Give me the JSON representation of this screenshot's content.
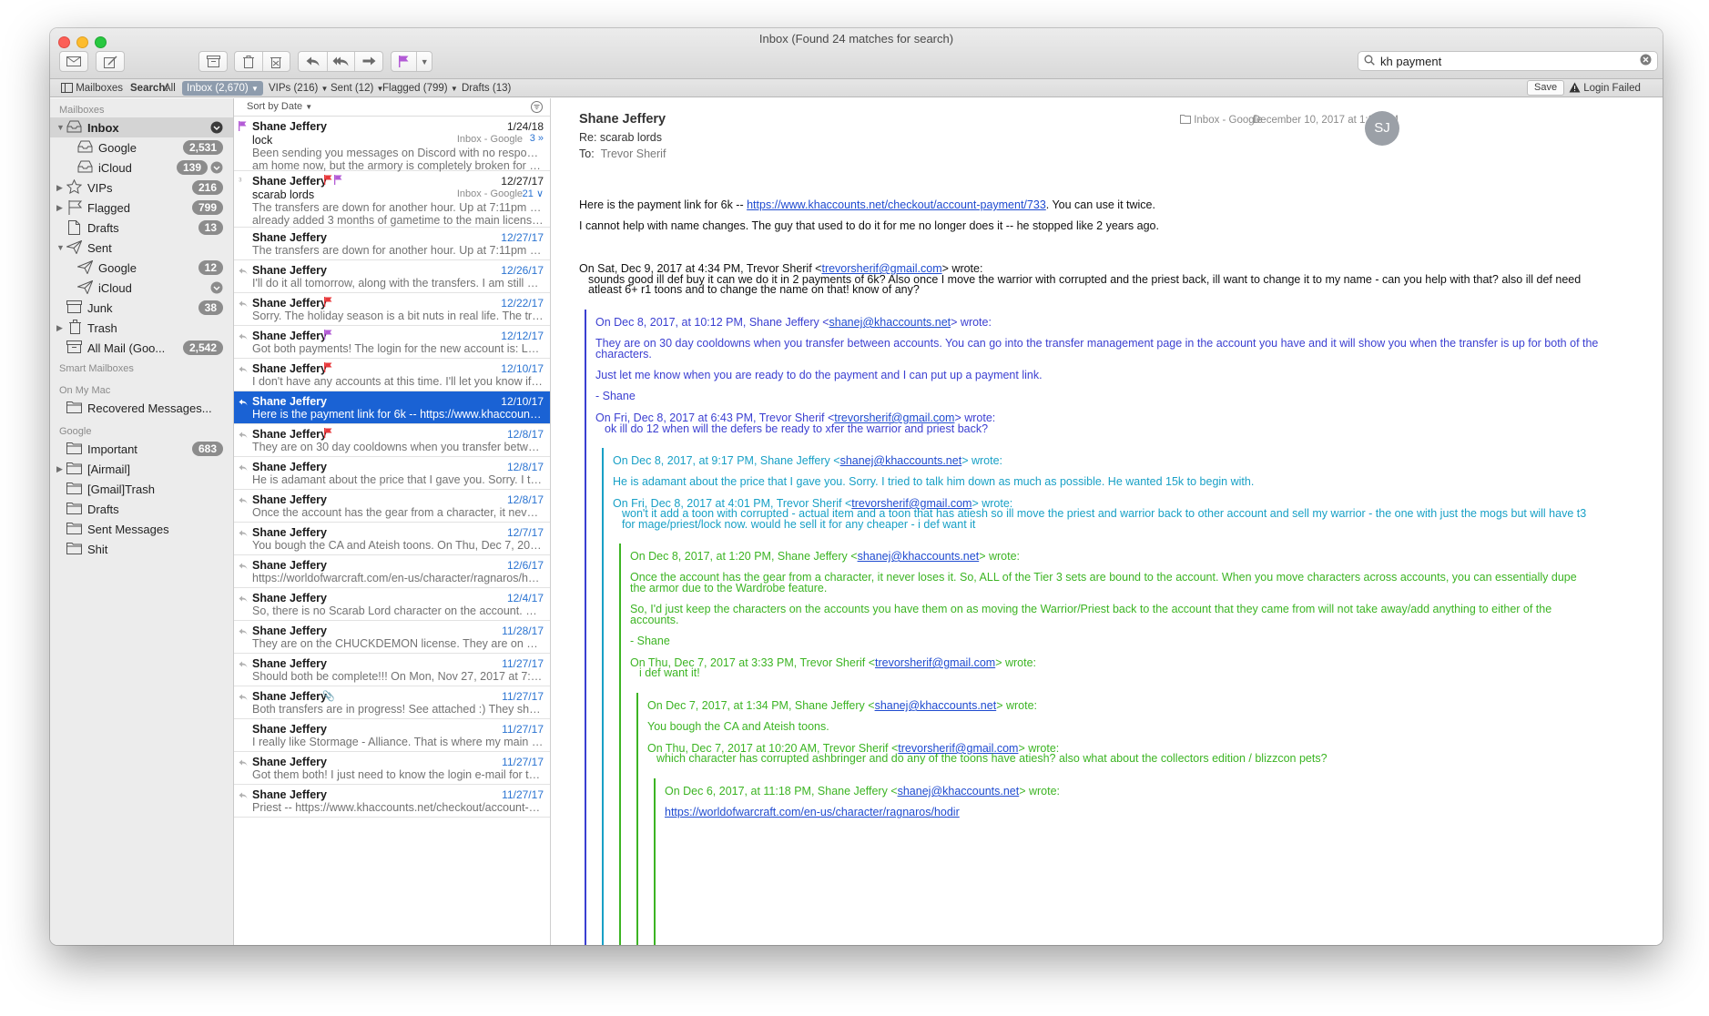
{
  "window": {
    "title": "Inbox (Found 24 matches for search)"
  },
  "toolbar": {
    "search_value": "kh payment"
  },
  "favbar": {
    "mailboxes": "Mailboxes",
    "search_label": "Search:",
    "all": "All",
    "inbox": "Inbox (2,670)",
    "vips": "VIPs (216)",
    "sent": "Sent (12)",
    "flagged": "Flagged (799)",
    "drafts": "Drafts (13)",
    "save": "Save",
    "login_failed": "Login Failed"
  },
  "sidebar": {
    "h_mailboxes": "Mailboxes",
    "h_smart": "Smart Mailboxes",
    "h_onmac": "On My Mac",
    "h_google": "Google",
    "inbox": "Inbox",
    "google": "Google",
    "google_count": "2,531",
    "icloud": "iCloud",
    "icloud_count": "139",
    "vips": "VIPs",
    "vips_count": "216",
    "flagged": "Flagged",
    "flagged_count": "799",
    "drafts": "Drafts",
    "drafts_count": "13",
    "sent": "Sent",
    "sent_google": "Google",
    "sent_google_count": "12",
    "sent_icloud": "iCloud",
    "junk": "Junk",
    "junk_count": "38",
    "trash": "Trash",
    "allmail": "All Mail (Goo...",
    "allmail_count": "2,542",
    "recovered": "Recovered Messages...",
    "important": "Important",
    "important_count": "683",
    "airmail": "[Airmail]",
    "gmail_trash": "[Gmail]Trash",
    "g_drafts": "Drafts",
    "sent_messages": "Sent Messages",
    "shit": "Shit"
  },
  "list": {
    "sort": "Sort by Date",
    "rows": [
      {
        "from": "Shane Jeffery",
        "date": "1/24/18",
        "subj": "lock",
        "acct": "Inbox - Google",
        "cnt": "3",
        "prev": "Been sending you messages on Discord with no response. I",
        "prev2": "am home now, but the armory is completely broken for all char..."
      },
      {
        "from": "Shane Jeffery",
        "date": "12/27/17",
        "subj": "scarab lords",
        "acct": "Inbox - Google",
        "cnt": "21",
        "prev": "The transfers are down for another hour.  Up at 7:11pm PST.  I",
        "prev2": "already added 3 months of gametime to the main license. On..."
      },
      {
        "from": "Shane Jeffery",
        "date": "12/27/17",
        "prev": "The transfers are down for another hour.  Up at 7:11pm PST.  I alre..."
      },
      {
        "from": "Shane Jeffery",
        "date": "12/26/17",
        "prev": "I'll do it all tomorrow, along with the transfers.  I am still dealing wi..."
      },
      {
        "from": "Shane Jeffery",
        "date": "12/22/17",
        "prev": "Sorry.  The holiday season is a bit nuts in real life.  The transfers f..."
      },
      {
        "from": "Shane Jeffery",
        "date": "12/12/17",
        "prev": "Got both payments! The login for the new account is: Login: ashbr..."
      },
      {
        "from": "Shane Jeffery",
        "date": "12/10/17",
        "prev": "I don't have any accounts at this time.  I'll let you know if anything..."
      },
      {
        "from": "Shane Jeffery",
        "date": "12/10/17",
        "prev": "Here is the payment link for 6k -- https://www.khaccounts.net/ch..."
      },
      {
        "from": "Shane Jeffery",
        "date": "12/8/17",
        "prev": "They are on 30 day cooldowns when you transfer between accou..."
      },
      {
        "from": "Shane Jeffery",
        "date": "12/8/17",
        "prev": "He is adamant about the price that I gave you.  Sorry.  I tried to tal..."
      },
      {
        "from": "Shane Jeffery",
        "date": "12/8/17",
        "prev": "Once the account has the gear from a character, it never loses it...."
      },
      {
        "from": "Shane Jeffery",
        "date": "12/7/17",
        "prev": "You bough the CA and Ateish toons. On Thu, Dec 7, 2017 at 10:20..."
      },
      {
        "from": "Shane Jeffery",
        "date": "12/6/17",
        "prev": "https://worldofwarcraft.com/en-us/character/ragnaros/hodir https..."
      },
      {
        "from": "Shane Jeffery",
        "date": "12/4/17",
        "prev": "So, there is no Scarab Lord character on the account.  He was mis..."
      },
      {
        "from": "Shane Jeffery",
        "date": "11/28/17",
        "prev": "They are on the CHUCKDEMON license.  They are on Stormrage s..."
      },
      {
        "from": "Shane Jeffery",
        "date": "11/27/17",
        "prev": "Should both be complete!!! On Mon, Nov 27, 2017 at 7:01 PM, Sha..."
      },
      {
        "from": "Shane Jeffery",
        "date": "11/27/17",
        "prev": "Both transfers are in progress!  See attached :) They should be th..."
      },
      {
        "from": "Shane Jeffery",
        "date": "11/27/17",
        "prev": "I really like Stormage - Alliance.  That is where my main is.  I can t..."
      },
      {
        "from": "Shane Jeffery",
        "date": "11/27/17",
        "prev": "Got them both! I just need to know the login e-mail for the accoun..."
      },
      {
        "from": "Shane Jeffery",
        "date": "11/27/17",
        "prev": "Priest -- https://www.khaccounts.net/checkout/account-payment/..."
      }
    ]
  },
  "message": {
    "from": "Shane Jeffery",
    "subject": "Re: scarab lords",
    "to_label": "To:",
    "to": "Trevor Sherif",
    "account": "Inbox - Google",
    "date": "December 10, 2017 at 1:23 PM",
    "initials": "SJ",
    "p1a": "Here is the payment link for 6k -- ",
    "p1link": "https://www.khaccounts.net/checkout/account-payment/733",
    "p1b": ".  You can use it twice.",
    "p2": "I cannot help with name changes.  The guy that used to do it for me no longer does it -- he stopped like 2 years ago.",
    "w1a": "On Sat, Dec 9, 2017 at 4:34 PM, Trevor Sherif <",
    "w1link": "trevorsherif@gmail.com",
    "w1b": "> wrote:",
    "w1t1": "sounds good   ill def buy it   can we do it in 2 payments of 6k?   Also once I move the warrior with corrupted and the priest back, ill want to change it to my name - can you help with that?  also  ill def need",
    "w1t2": "atleast  6+ r1 toons and to change the name on that! know of any?",
    "q1a": "On Dec 8, 2017, at 10:12 PM, Shane Jeffery <",
    "q1link": "shanej@khaccounts.net",
    "q1b": "> wrote:",
    "q1p1a": "They are on 30 day cooldowns when you transfer between accounts.  You can go into the transfer management page in the account you have and it will show you when the transfer is up for both of the",
    "q1p1b": "characters.",
    "q1p2": "Just let me know when you are ready to do the payment and I can put up a payment link.",
    "q1p3": "- Shane",
    "q1wa": "On Fri, Dec 8, 2017 at 6:43 PM, Trevor Sherif <",
    "q1wlink": "trevorsherif@gmail.com",
    "q1wb": "> wrote:",
    "q1wt": "ok ill do 12     when will the defers be ready to xfer the warrior and priest back?",
    "q2a": "On Dec 8, 2017, at 9:17 PM, Shane Jeffery <",
    "q2link": "shanej@khaccounts.net",
    "q2b": "> wrote:",
    "q2p1": "He is adamant about the price that I gave you.  Sorry.  I tried to talk him down as much as possible.  He wanted 15k to begin with.",
    "q2wa": "On Fri, Dec 8, 2017 at 4:01 PM, Trevor Sherif <",
    "q2wlink": "trevorsherif@gmail.com",
    "q2wb": "> wrote:",
    "q2wt1": "won't it add a toon with corrupted - actual item and a toon that has atiesh so ill move the priest and warrior back to other account and sell my warrior - the one with just the mogs but will have t3",
    "q2wt2": "for mage/priest/lock now.  would he sell it for any cheaper - i def want it",
    "q3a": "On Dec 8, 2017, at 1:20 PM, Shane Jeffery <",
    "q3link": "shanej@khaccounts.net",
    "q3b": "> wrote:",
    "q3p1a": "Once the account has the gear from a character, it never loses it.  So, ALL of the Tier 3 sets are bound to the account.  When you move characters across accounts, you can essentially dupe",
    "q3p1b": "the armor due to the Wardrobe feature.",
    "q3p2a": "So, I'd just keep the characters on the accounts you have them on as moving the Warrior/Priest back to the account that they came from will not take away/add anything to either of the",
    "q3p2b": "accounts.",
    "q3p3": "- Shane",
    "q3wa": "On Thu, Dec 7, 2017 at 3:33 PM, Trevor Sherif <",
    "q3wlink": "trevorsherif@gmail.com",
    "q3wb": "> wrote:",
    "q3wt": "i def want it!",
    "q4a": "On Dec 7, 2017, at 1:34 PM, Shane Jeffery <",
    "q4link": "shanej@khaccounts.net",
    "q4b": "> wrote:",
    "q4p1": "You bough the CA and Ateish toons.",
    "q4wa": "On Thu, Dec 7, 2017 at 10:20 AM, Trevor Sherif <",
    "q4wlink": "trevorsherif@gmail.com",
    "q4wb": "> wrote:",
    "q4wt": "which character has corrupted ashbringer and do any of the toons have atiesh? also what about the collectors edition / blizzcon pets?",
    "q5a": "On Dec 6, 2017, at 11:18 PM, Shane Jeffery <",
    "q5link": "shanej@khaccounts.net",
    "q5b": "> wrote:",
    "q5p1": "https://worldofwarcraft.com/en-us/character/ragnaros/hodir"
  },
  "colors": {
    "selection": "#1a62d4",
    "quote1": "#3b3fd1",
    "quote2": "#18a0c6",
    "quote3": "#3cb423",
    "flag_red": "#e8383b",
    "flag_purple": "#b35bd6"
  }
}
